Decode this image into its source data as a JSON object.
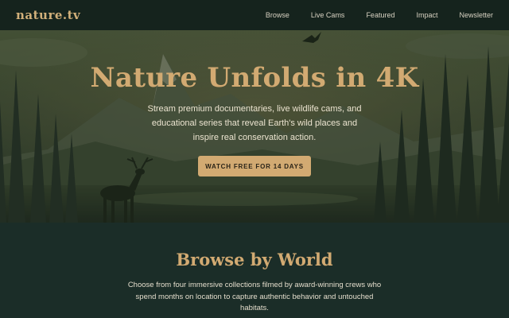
{
  "header": {
    "logo": "nature.tv",
    "nav": [
      {
        "label": "Browse"
      },
      {
        "label": "Live Cams"
      },
      {
        "label": "Featured"
      },
      {
        "label": "Impact"
      },
      {
        "label": "Newsletter"
      }
    ]
  },
  "hero": {
    "title": "Nature Unfolds in 4K",
    "subtitle": "Stream premium documentaries, live wildlife cams, and educational series that reveal Earth's wild places and inspire real conservation action.",
    "cta_label": "WATCH FREE FOR 14 DAYS"
  },
  "browse": {
    "title": "Browse by World",
    "description": "Choose from four immersive collections filmed by award-winning crews who spend months on location to capture authentic behavior and untouched habitats."
  },
  "colors": {
    "accent": "#d2aa72",
    "header_bg": "#15231d",
    "section_bg": "#1b2d28"
  },
  "icons": {
    "hero_illustration": "mountain-forest-deer-scene",
    "bird": "bird-icon",
    "deer": "deer-icon"
  }
}
